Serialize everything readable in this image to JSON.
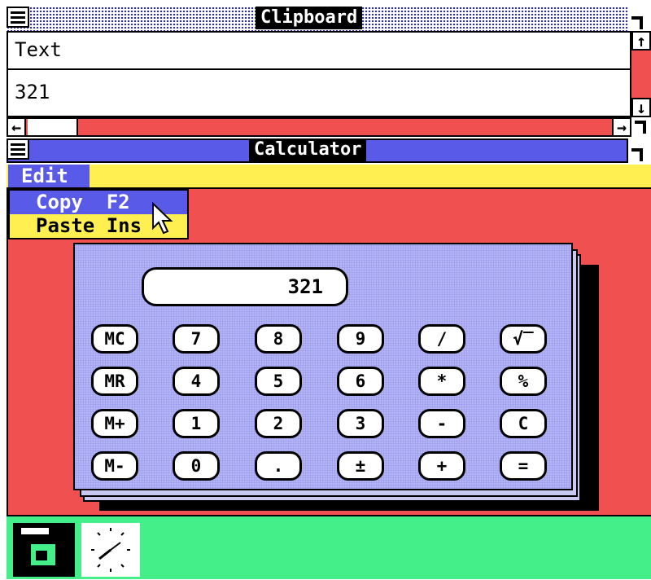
{
  "clipboard": {
    "title": "Clipboard",
    "format_label": "Text",
    "content": "321"
  },
  "calculator": {
    "title": "Calculator",
    "menu": {
      "edit_label": "Edit"
    },
    "edit_menu": {
      "items": [
        {
          "label": "Copy  F2"
        },
        {
          "label": "Paste Ins"
        }
      ]
    },
    "display": "321",
    "buttons": [
      [
        "MC",
        "7",
        "8",
        "9",
        "/",
        "√‾"
      ],
      [
        "MR",
        "4",
        "5",
        "6",
        "*",
        "%"
      ],
      [
        "M+",
        "1",
        "2",
        "3",
        "-",
        "C"
      ],
      [
        "M-",
        "0",
        ".",
        "±",
        "+",
        "="
      ]
    ]
  },
  "icons": {
    "scroll_up": "arrow-up-icon",
    "scroll_down": "arrow-down-icon",
    "scroll_left": "arrow-left-icon",
    "scroll_right": "arrow-right-icon",
    "cursor": "mouse-pointer-icon",
    "disk": "floppy-disk-icon",
    "clock": "clock-icon"
  },
  "colors": {
    "desktop": "#f05050",
    "titlebar": "#5a5ae8",
    "menu_bar": "#ffef50",
    "calc_face": "#b4b4f8",
    "taskbar": "#44ee88"
  }
}
